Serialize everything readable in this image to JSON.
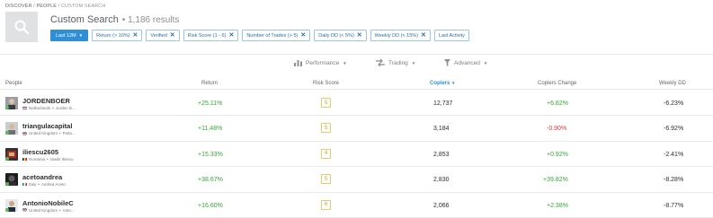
{
  "breadcrumb": [
    "DISCOVER",
    "PEOPLE",
    "CUSTOM SEARCH"
  ],
  "header": {
    "title": "Custom Search",
    "results": "• 1,186 results"
  },
  "filters": {
    "period": "Last 12M",
    "chips": [
      "Return (> 10%)",
      "Verified",
      "Risk Score (1 - 6)",
      "Number of Trades (> 5)",
      "Daily DD (< 5%)",
      "Weekly DD (< 15%)",
      "Last Activity"
    ]
  },
  "toolbar": {
    "performance": "Performance",
    "trading": "Trading",
    "advanced": "Advanced"
  },
  "columns": {
    "people": "People",
    "return": "Return",
    "risk_score": "Risk Score",
    "copiers": "Copiers",
    "copiers_change": "Copiers Change",
    "weekly_dd": "Weekly DD"
  },
  "rows": [
    {
      "username": "JORDENBOER",
      "country": "Netherlands",
      "fullname": "Jorden B...",
      "return": "+25.11%",
      "risk": "5",
      "copiers": "12,737",
      "copiers_change": "+6.82%",
      "change_positive": true,
      "weekly_dd": "-6.23%",
      "flag": "nl"
    },
    {
      "username": "triangulacapital",
      "country": "United Kingdom",
      "fullname": "Pieta...",
      "return": "+11.48%",
      "risk": "5",
      "copiers": "3,184",
      "copiers_change": "-0.90%",
      "change_positive": false,
      "weekly_dd": "-6.92%",
      "flag": "uk"
    },
    {
      "username": "iliescu2605",
      "country": "Romania",
      "fullname": "Vasile Iliescu",
      "return": "+15.33%",
      "risk": "4",
      "copiers": "2,853",
      "copiers_change": "+0.92%",
      "change_positive": true,
      "weekly_dd": "-2.41%",
      "flag": "ro"
    },
    {
      "username": "acetoandrea",
      "country": "Italy",
      "fullname": "Andrea Aceto",
      "return": "+38.67%",
      "risk": "5",
      "copiers": "2,830",
      "copiers_change": "+39.82%",
      "change_positive": true,
      "weekly_dd": "-8.28%",
      "flag": "it"
    },
    {
      "username": "AntonioNobileC",
      "country": "United Kingdom",
      "fullname": "Anto...",
      "return": "+16.60%",
      "risk": "6",
      "copiers": "2,066",
      "copiers_change": "+2.38%",
      "change_positive": true,
      "weekly_dd": "-8.77%",
      "flag": "uk"
    }
  ],
  "colors": {
    "accent": "#2e8fd6",
    "positive": "#3aa43a",
    "negative": "#d43b3b",
    "risk_border": "#e6c96b"
  }
}
